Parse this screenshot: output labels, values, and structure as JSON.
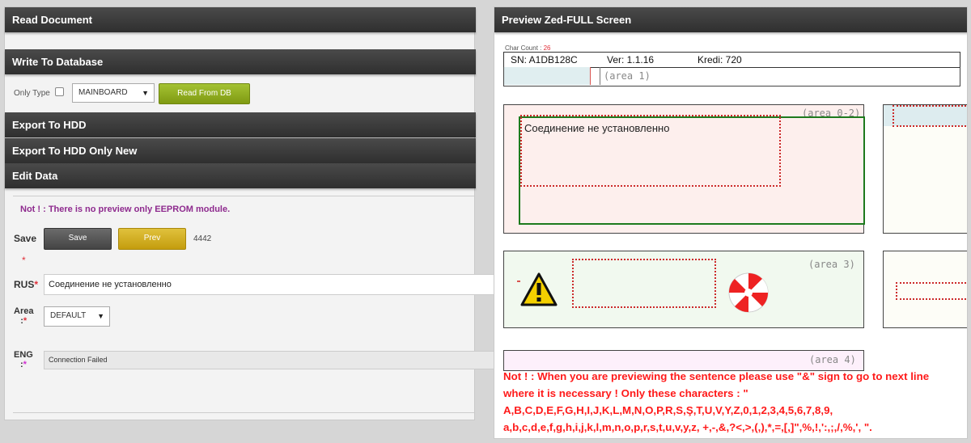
{
  "left_panel": {
    "sections": {
      "read_document": "Read Document",
      "write_to_database": "Write To Database",
      "export_to_hdd": "Export To HDD",
      "export_to_hdd_only_new": "Export To HDD Only New",
      "edit_data": "Edit Data"
    },
    "db_row": {
      "only_type_label": "Only Type",
      "only_type_checked": false,
      "type_select_value": "MAINBOARD",
      "read_from_db_button": "Read From DB"
    },
    "edit": {
      "notice": "Not ! : There is no preview only EEPROM module.",
      "save_label": "Save",
      "save_button": "Save",
      "prev_button": "Prev",
      "record_id": "4442",
      "required_star": "*",
      "rus_label": "RUS",
      "rus_value": "Соединение не установленно",
      "area_label": "Area",
      "area_colon": ":",
      "area_select_value": "DEFAULT",
      "eng_label": "ENG",
      "eng_colon": ":",
      "eng_value": "Connection Failed"
    }
  },
  "right_panel": {
    "title": "Preview Zed-FULL Screen",
    "char_count_label": "Char Count :",
    "char_count_value": "26",
    "sn": "SN: A1DB128C",
    "ver": "Ver:  1.1.16",
    "kredi": "Kredi:  720",
    "areas": {
      "area1": "(area 1)",
      "area02": "(area 0-2)",
      "area3": "(area 3)",
      "area4": "(area 4)"
    },
    "area02_text": "Соединение не установленно",
    "icons": {
      "warning": "warning-triangle-icon",
      "lifebuoy": "lifebuoy-icon"
    },
    "colors": {
      "warning_text": "#ff1a1a",
      "notice_text": "#8e2a8e",
      "dotted_border": "#cc2a2a",
      "active_border": "#1d7a1d"
    },
    "warning_message": "Not ! : When you are previewing the sentence please use \"&\" sign to go to next line where it is necessary ! Only these characters : \" A,B,C,D,E,F,G,H,I,J,K,L,M,N,O,P,R,S,Ş,T,U,V,Y,Z,0,1,2,3,4,5,6,7,8,9, a,b,c,d,e,f,g,h,i,j,k,l,m,n,o,p,r,s,t,u,v,y,z, +,-,&,?<,>,(,),*,=,[,]\",%,!,':,;,/,%,', \"."
  }
}
